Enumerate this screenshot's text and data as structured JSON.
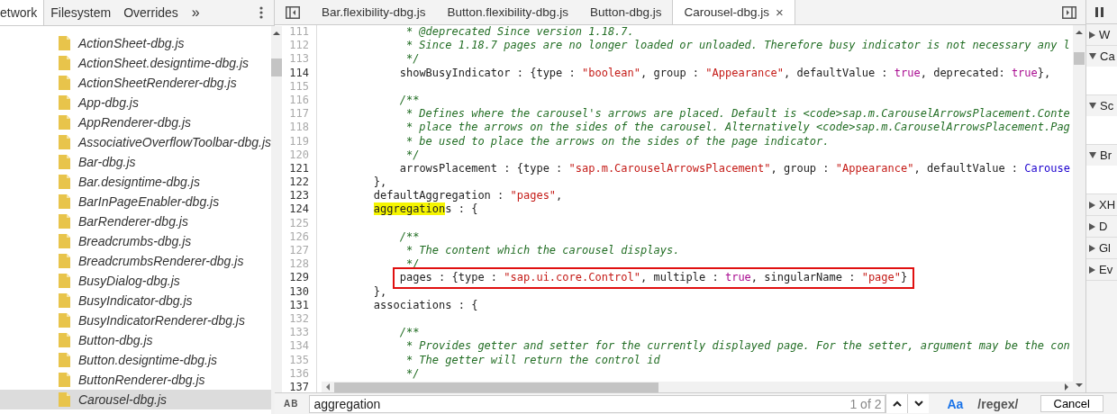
{
  "navigator": {
    "tabs": [
      {
        "label": "etwork",
        "selected": true
      },
      {
        "label": "Filesystem",
        "selected": false
      },
      {
        "label": "Overrides",
        "selected": false
      }
    ],
    "more": "»",
    "files": [
      {
        "name": "ActionSheet-dbg.js",
        "selected": false
      },
      {
        "name": "ActionSheet.designtime-dbg.js",
        "selected": false
      },
      {
        "name": "ActionSheetRenderer-dbg.js",
        "selected": false
      },
      {
        "name": "App-dbg.js",
        "selected": false
      },
      {
        "name": "AppRenderer-dbg.js",
        "selected": false
      },
      {
        "name": "AssociativeOverflowToolbar-dbg.js",
        "selected": false
      },
      {
        "name": "Bar-dbg.js",
        "selected": false
      },
      {
        "name": "Bar.designtime-dbg.js",
        "selected": false
      },
      {
        "name": "BarInPageEnabler-dbg.js",
        "selected": false
      },
      {
        "name": "BarRenderer-dbg.js",
        "selected": false
      },
      {
        "name": "Breadcrumbs-dbg.js",
        "selected": false
      },
      {
        "name": "BreadcrumbsRenderer-dbg.js",
        "selected": false
      },
      {
        "name": "BusyDialog-dbg.js",
        "selected": false
      },
      {
        "name": "BusyIndicator-dbg.js",
        "selected": false
      },
      {
        "name": "BusyIndicatorRenderer-dbg.js",
        "selected": false
      },
      {
        "name": "Button-dbg.js",
        "selected": false
      },
      {
        "name": "Button.designtime-dbg.js",
        "selected": false
      },
      {
        "name": "ButtonRenderer-dbg.js",
        "selected": false
      },
      {
        "name": "Carousel-dbg.js",
        "selected": true
      }
    ]
  },
  "editor": {
    "tabs": [
      {
        "label": "Bar.flexibility-dbg.js",
        "selected": false,
        "closable": false
      },
      {
        "label": "Button.flexibility-dbg.js",
        "selected": false,
        "closable": false
      },
      {
        "label": "Button-dbg.js",
        "selected": false,
        "closable": false
      },
      {
        "label": "Carousel-dbg.js",
        "selected": true,
        "closable": true
      }
    ],
    "close_glyph": "×",
    "lines": [
      {
        "number": "111",
        "dim": true,
        "tokens": [
          {
            "kind": "comment",
            "text": "             * @deprecated Since version 1.18.7."
          }
        ]
      },
      {
        "number": "112",
        "dim": true,
        "tokens": [
          {
            "kind": "comment",
            "text": "             * Since 1.18.7 pages are no longer loaded or unloaded. Therefore busy indicator is not necessary any l"
          }
        ]
      },
      {
        "number": "113",
        "dim": true,
        "tokens": [
          {
            "kind": "comment",
            "text": "             */"
          }
        ]
      },
      {
        "number": "114",
        "dim": false,
        "tokens": [
          {
            "kind": "plain",
            "text": "            showBusyIndicator : {type : "
          },
          {
            "kind": "string",
            "text": "\"boolean\""
          },
          {
            "kind": "plain",
            "text": ", group : "
          },
          {
            "kind": "string",
            "text": "\"Appearance\""
          },
          {
            "kind": "plain",
            "text": ", defaultValue : "
          },
          {
            "kind": "keyword",
            "text": "true"
          },
          {
            "kind": "plain",
            "text": ", deprecated: "
          },
          {
            "kind": "keyword",
            "text": "true"
          },
          {
            "kind": "plain",
            "text": "},"
          }
        ]
      },
      {
        "number": "115",
        "dim": true
      },
      {
        "number": "116",
        "dim": true,
        "tokens": [
          {
            "kind": "comment",
            "text": "            /**"
          }
        ]
      },
      {
        "number": "117",
        "dim": true,
        "tokens": [
          {
            "kind": "comment",
            "text": "             * Defines where the carousel's arrows are placed. Default is <code>sap.m.CarouselArrowsPlacement.Conte"
          }
        ]
      },
      {
        "number": "118",
        "dim": true,
        "tokens": [
          {
            "kind": "comment",
            "text": "             * place the arrows on the sides of the carousel. Alternatively <code>sap.m.CarouselArrowsPlacement.Pag"
          }
        ]
      },
      {
        "number": "119",
        "dim": true,
        "tokens": [
          {
            "kind": "comment",
            "text": "             * be used to place the arrows on the sides of the page indicator."
          }
        ]
      },
      {
        "number": "120",
        "dim": true,
        "tokens": [
          {
            "kind": "comment",
            "text": "             */"
          }
        ]
      },
      {
        "number": "121",
        "dim": false,
        "tokens": [
          {
            "kind": "plain",
            "text": "            arrowsPlacement : {type : "
          },
          {
            "kind": "string",
            "text": "\"sap.m.CarouselArrowsPlacement\""
          },
          {
            "kind": "plain",
            "text": ", group : "
          },
          {
            "kind": "string",
            "text": "\"Appearance\""
          },
          {
            "kind": "plain",
            "text": ", defaultValue : "
          },
          {
            "kind": "type",
            "text": "Carouse"
          }
        ]
      },
      {
        "number": "122",
        "dim": false,
        "tokens": [
          {
            "kind": "plain",
            "text": "        },"
          }
        ]
      },
      {
        "number": "123",
        "dim": false,
        "tokens": [
          {
            "kind": "plain",
            "text": "        defaultAggregation : "
          },
          {
            "kind": "string",
            "text": "\"pages\""
          },
          {
            "kind": "plain",
            "text": ","
          }
        ]
      },
      {
        "number": "124",
        "dim": false,
        "tokens": [
          {
            "kind": "match",
            "text": "        aggregation"
          },
          {
            "kind": "plain",
            "text": "s : {"
          }
        ]
      },
      {
        "number": "125",
        "dim": true
      },
      {
        "number": "126",
        "dim": true,
        "tokens": [
          {
            "kind": "comment",
            "text": "            /**"
          }
        ]
      },
      {
        "number": "127",
        "dim": true,
        "tokens": [
          {
            "kind": "comment",
            "text": "             * The content which the carousel displays."
          }
        ]
      },
      {
        "number": "128",
        "dim": true,
        "tokens": [
          {
            "kind": "comment",
            "text": "             */"
          }
        ]
      },
      {
        "number": "129",
        "dim": false,
        "boxed": true,
        "tokens": [
          {
            "kind": "plain",
            "text": "            pages : {type : "
          },
          {
            "kind": "string",
            "text": "\"sap.ui.core.Control\""
          },
          {
            "kind": "plain",
            "text": ", multiple : "
          },
          {
            "kind": "keyword",
            "text": "true"
          },
          {
            "kind": "plain",
            "text": ", singularName : "
          },
          {
            "kind": "string",
            "text": "\"page\""
          },
          {
            "kind": "plain",
            "text": "}"
          }
        ]
      },
      {
        "number": "130",
        "dim": false,
        "tokens": [
          {
            "kind": "plain",
            "text": "        },"
          }
        ]
      },
      {
        "number": "131",
        "dim": false,
        "tokens": [
          {
            "kind": "plain",
            "text": "        associations : {"
          }
        ]
      },
      {
        "number": "132",
        "dim": true
      },
      {
        "number": "133",
        "dim": true,
        "tokens": [
          {
            "kind": "comment",
            "text": "            /**"
          }
        ]
      },
      {
        "number": "134",
        "dim": true,
        "tokens": [
          {
            "kind": "comment",
            "text": "             * Provides getter and setter for the currently displayed page. For the setter, argument may be the con"
          }
        ]
      },
      {
        "number": "135",
        "dim": true,
        "tokens": [
          {
            "kind": "comment",
            "text": "             * The getter will return the control id"
          }
        ]
      },
      {
        "number": "136",
        "dim": true,
        "tokens": [
          {
            "kind": "comment",
            "text": "             */"
          }
        ]
      }
    ],
    "last_line_number": "137"
  },
  "sidebar": {
    "sections": [
      {
        "label": "W",
        "expanded": false
      },
      {
        "label": "Ca",
        "expanded": true
      },
      {
        "label": "Sc",
        "expanded": true
      },
      {
        "label": "Br",
        "expanded": true
      },
      {
        "label": "XH",
        "expanded": false
      },
      {
        "label": "D",
        "expanded": false
      },
      {
        "label": "Gl",
        "expanded": false
      },
      {
        "label": "Ev",
        "expanded": false
      }
    ]
  },
  "search": {
    "replace_toggle": "AB",
    "value": "aggregation",
    "count": "1 of 2",
    "match_case": "Aa",
    "regex": "/regex/",
    "cancel": "Cancel"
  }
}
